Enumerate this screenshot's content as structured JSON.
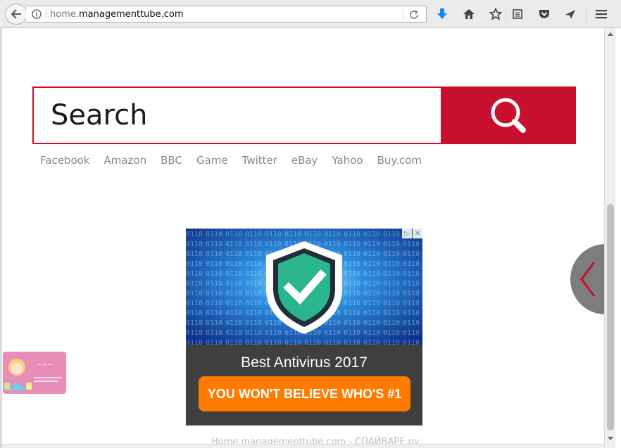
{
  "browser": {
    "url_prefix": "home.",
    "url_domain": "managementtube.com",
    "toolbar_icons": [
      "back-arrow-icon",
      "info-icon",
      "reload-icon",
      "download-icon",
      "home-icon",
      "bookmark-star-icon",
      "reading-list-icon",
      "pocket-icon",
      "send-icon",
      "menu-icon"
    ]
  },
  "search": {
    "placeholder": "Search"
  },
  "quick_links": [
    "Facebook",
    "Amazon",
    "BBC",
    "Game",
    "Twitter",
    "eBay",
    "Yahoo",
    "Buy.com"
  ],
  "ad": {
    "title": "Best Antivirus 2017",
    "cta": "YOU WON'T BELIEVE WHO'S #1",
    "adchoice_icons": [
      "adchoices-icon",
      "close-icon"
    ]
  },
  "watermark": "Home.managementtube.com - СПАЙВАРЕ.ру",
  "colors": {
    "accent": "#c8102e",
    "cta": "#ff7a00",
    "ad_bg": "#3f3f3f",
    "shield": "#2ab58c"
  }
}
